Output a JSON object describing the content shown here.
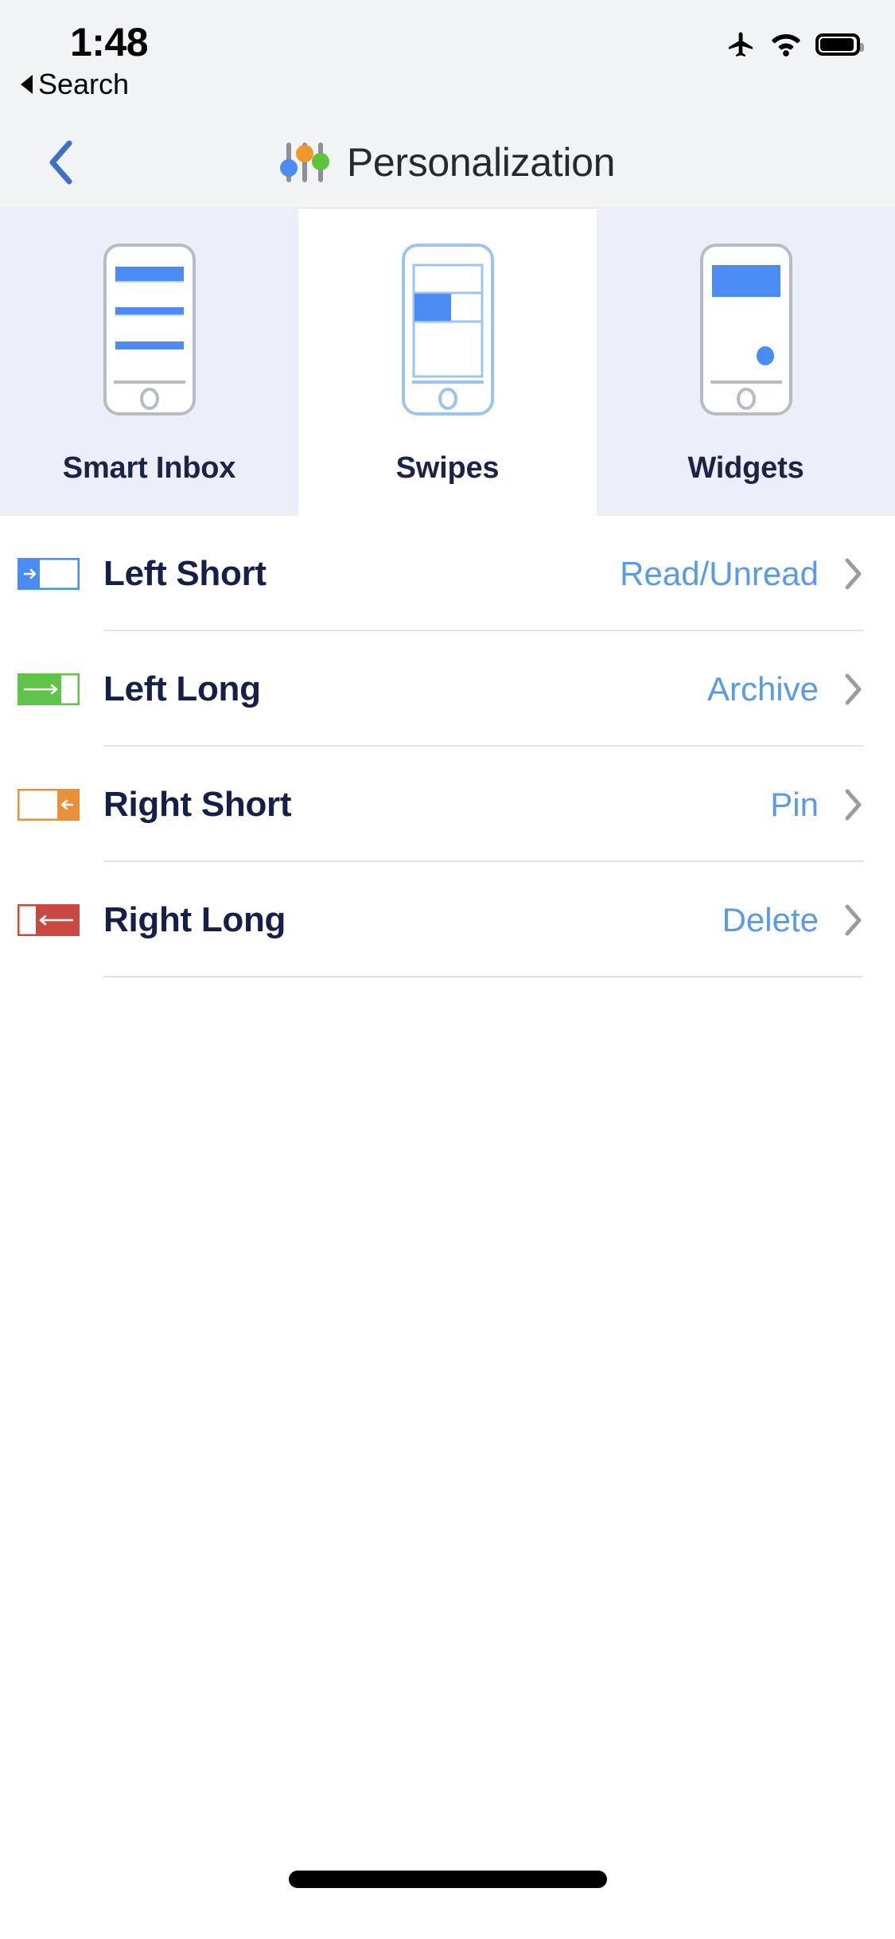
{
  "status_bar": {
    "time": "1:48",
    "back_label": "Search",
    "icons": [
      "airplane-mode-icon",
      "wifi-icon",
      "battery-icon"
    ]
  },
  "nav_bar": {
    "back_icon": "chevron-left-icon",
    "title": "Personalization",
    "title_icon": "sliders-icon",
    "icon_colors": {
      "knob_blue": "#4b8bf4",
      "knob_orange": "#f0982e",
      "knob_green": "#5ec33c",
      "track_gray": "#8c9199"
    }
  },
  "tabs": [
    {
      "label": "Smart Inbox",
      "art": "phone-smart-inbox-icon",
      "selected": false
    },
    {
      "label": "Swipes",
      "art": "phone-swipes-icon",
      "selected": true
    },
    {
      "label": "Widgets",
      "art": "phone-widgets-icon",
      "selected": false
    }
  ],
  "swipe_rows": [
    {
      "title": "Left Short",
      "value": "Read/Unread",
      "icon": "swipe-left-short-icon",
      "color": "#4b8bf4",
      "direction": "right",
      "length": "short"
    },
    {
      "title": "Left Long",
      "value": "Archive",
      "icon": "swipe-left-long-icon",
      "color": "#62c34a",
      "direction": "right",
      "length": "long"
    },
    {
      "title": "Right Short",
      "value": "Pin",
      "icon": "swipe-right-short-icon",
      "color": "#e8903a",
      "direction": "left",
      "length": "short"
    },
    {
      "title": "Right Long",
      "value": "Delete",
      "icon": "swipe-right-long-icon",
      "color": "#cb4741",
      "direction": "left",
      "length": "long"
    }
  ],
  "colors": {
    "accent_value": "#5a9ae6",
    "title_text": "#15204a",
    "chrome_bg": "#f2f3f5",
    "tab_unselected_bg": "#eceefa",
    "tab_selected_bg": "#ffffff",
    "separator": "#e3e4e6",
    "chevron": "#9a9ca1"
  },
  "home_indicator": "home-indicator"
}
